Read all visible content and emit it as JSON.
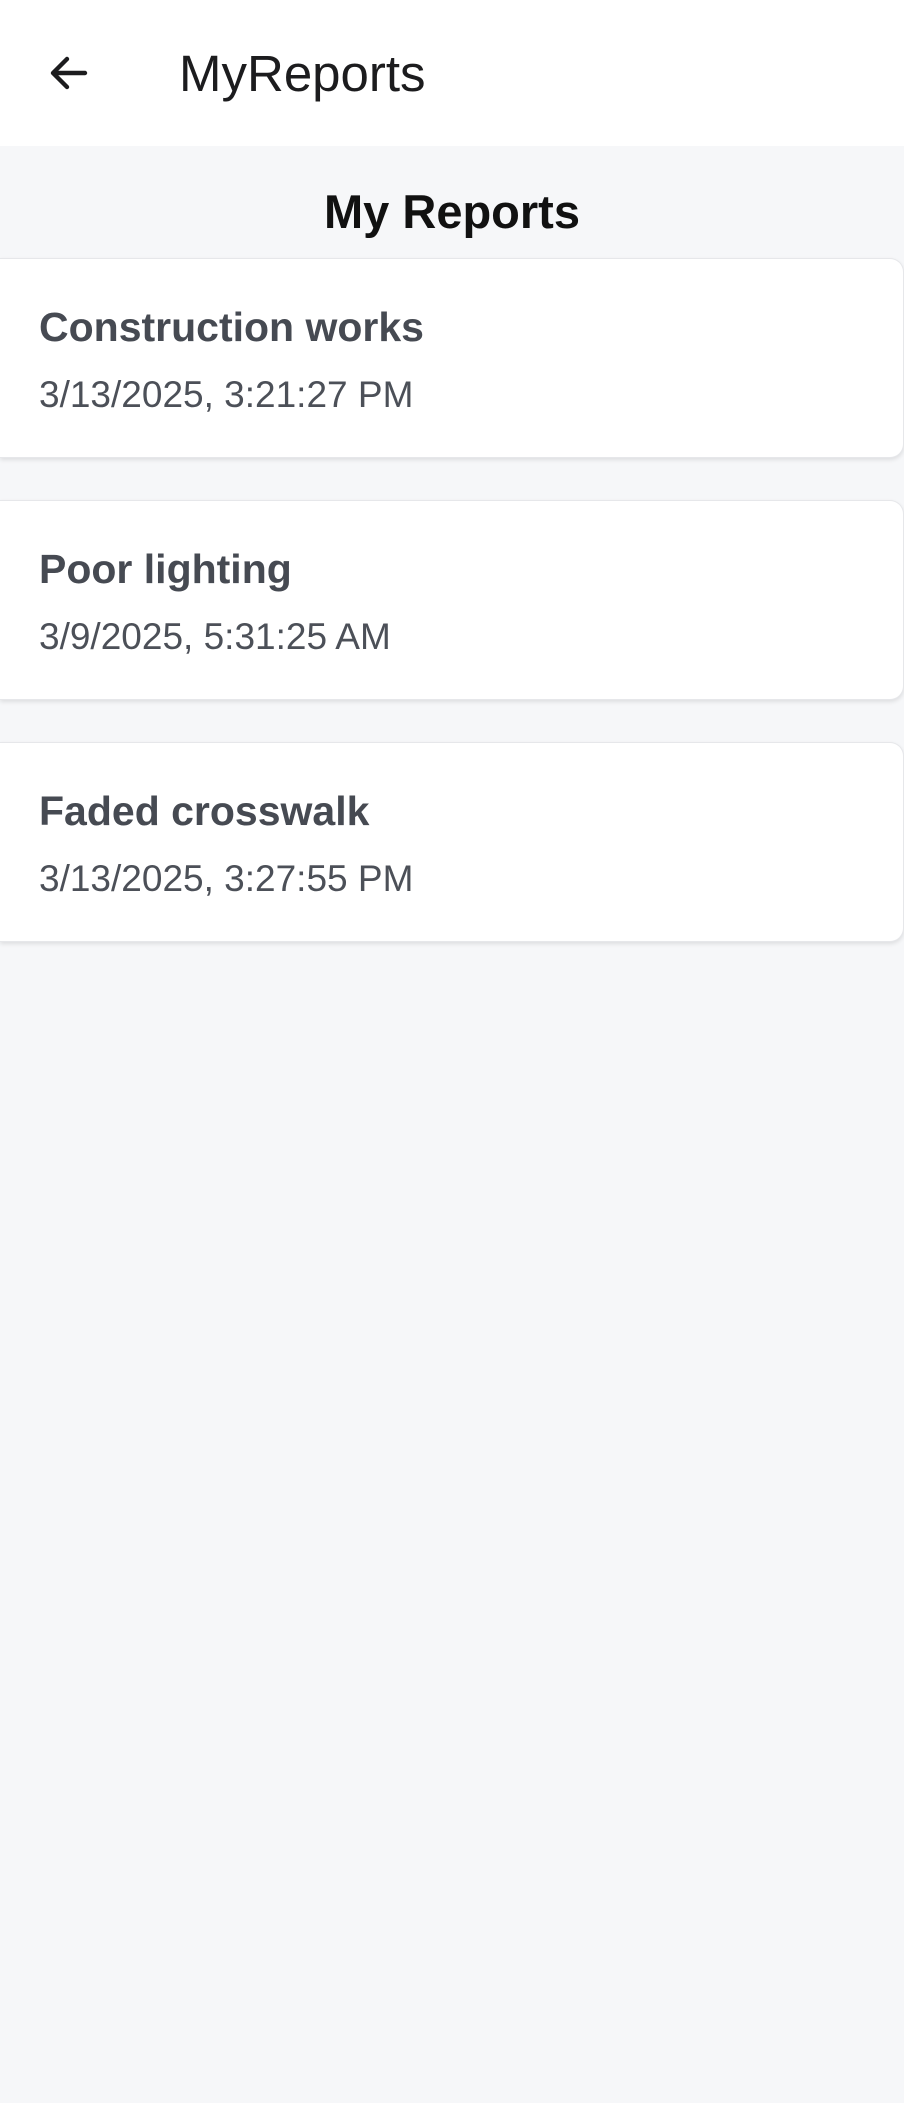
{
  "app_bar": {
    "back_icon": "arrow-left-icon",
    "title": "MyReports"
  },
  "main": {
    "heading": "My Reports",
    "reports": [
      {
        "title": "Construction works",
        "datetime": "3/13/2025, 3:21:27 PM"
      },
      {
        "title": "Poor lighting",
        "datetime": "3/9/2025, 5:31:25 AM"
      },
      {
        "title": "Faded crosswalk",
        "datetime": "3/13/2025, 3:27:55 PM"
      }
    ]
  },
  "colors": {
    "background": "#f6f7f9",
    "card": "#ffffff",
    "title_text": "#464a52",
    "date_text": "#4c5058"
  }
}
